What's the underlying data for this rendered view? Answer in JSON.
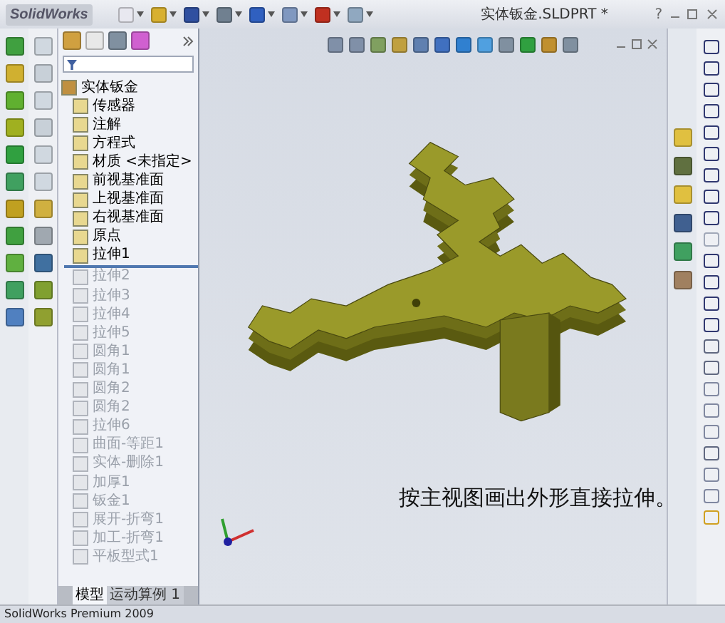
{
  "app": {
    "logo": "SolidWorks",
    "help": "?"
  },
  "window": {
    "title": "实体钣金.SLDPRT *"
  },
  "feature_tree": {
    "root": "实体钣金",
    "children": [
      {
        "label": "传感器",
        "rolled_back": false
      },
      {
        "label": "注解",
        "rolled_back": false
      },
      {
        "label": "方程式",
        "rolled_back": false
      },
      {
        "label": "材质 <未指定>",
        "rolled_back": false
      },
      {
        "label": "前视基准面",
        "rolled_back": false
      },
      {
        "label": "上视基准面",
        "rolled_back": false
      },
      {
        "label": "右视基准面",
        "rolled_back": false
      },
      {
        "label": "原点",
        "rolled_back": false
      },
      {
        "label": "拉伸1",
        "rolled_back": false
      },
      {
        "label": "拉伸2",
        "rolled_back": true
      },
      {
        "label": "拉伸3",
        "rolled_back": true
      },
      {
        "label": "拉伸4",
        "rolled_back": true
      },
      {
        "label": "拉伸5",
        "rolled_back": true
      },
      {
        "label": "圆角1",
        "rolled_back": true
      },
      {
        "label": "圆角1",
        "rolled_back": true
      },
      {
        "label": "圆角2",
        "rolled_back": true
      },
      {
        "label": "圆角2",
        "rolled_back": true
      },
      {
        "label": "拉伸6",
        "rolled_back": true
      },
      {
        "label": "曲面-等距1",
        "rolled_back": true
      },
      {
        "label": "实体-删除1",
        "rolled_back": true
      },
      {
        "label": "加厚1",
        "rolled_back": true
      },
      {
        "label": "钣金1",
        "rolled_back": true
      },
      {
        "label": "展开-折弯1",
        "rolled_back": true
      },
      {
        "label": "加工-折弯1",
        "rolled_back": true
      },
      {
        "label": "平板型式1",
        "rolled_back": true
      }
    ]
  },
  "bottom_tabs": [
    {
      "label": "模型",
      "selected": true
    },
    {
      "label": "运动算例 1",
      "selected": false
    }
  ],
  "graphics": {
    "caption": "按主视图画出外形直接拉伸。"
  },
  "status_bar": {
    "text": "SolidWorks Premium 2009"
  }
}
